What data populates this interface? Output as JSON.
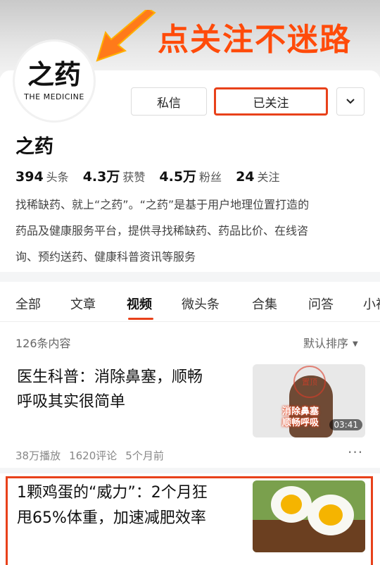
{
  "banner": {
    "text": "点关注不迷路"
  },
  "profile": {
    "logo_cn": "之药",
    "logo_en": "THE MEDICINE",
    "name": "之药",
    "message_button": "私信",
    "follow_button": "已关注",
    "stats": [
      {
        "value": "394",
        "label": "头条"
      },
      {
        "value": "4.3万",
        "label": "获赞"
      },
      {
        "value": "4.5万",
        "label": "粉丝"
      },
      {
        "value": "24",
        "label": "关注"
      }
    ],
    "bio_lines": [
      "找稀缺药、就上“之药”。“之药”是基于用户地理位置打造的",
      "药品及健康服务平台，提供寻找稀缺药、药品比价、在线咨",
      "询、预约送药、健康科普资讯等服务"
    ]
  },
  "tabs": [
    "全部",
    "文章",
    "视频",
    "微头条",
    "合集",
    "问答",
    "小视"
  ],
  "active_tab": "视频",
  "list": {
    "count": "126条内容",
    "sort": "默认排序"
  },
  "items": [
    {
      "title_lines": [
        "医生科普：消除鼻塞，顺畅",
        "呼吸其实很简单"
      ],
      "thumb_caption": [
        "消除鼻塞",
        "顺畅呼吸"
      ],
      "thumb_stamp": "置顶",
      "duration": "03:41",
      "plays": "38万播放",
      "comments": "1620评论",
      "time": "5个月前"
    },
    {
      "title_lines": [
        "1颗鸡蛋的“威力”：2个月狂",
        "甩65%体重，加速减肥效率"
      ]
    }
  ],
  "colors": {
    "accent": "#e8411a",
    "banner": "#ff4b0a"
  }
}
